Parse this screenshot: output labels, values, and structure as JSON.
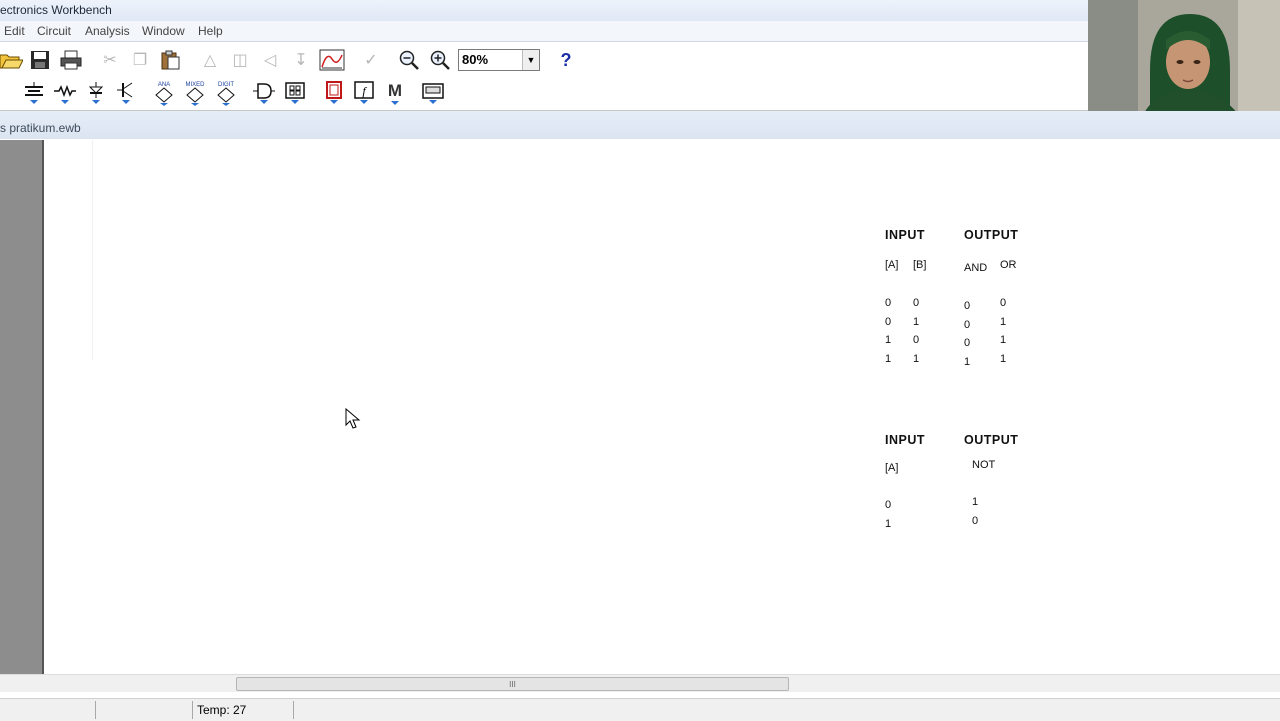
{
  "window": {
    "title": "ectronics Workbench"
  },
  "menu": {
    "items": [
      "Edit",
      "Circuit",
      "Analysis",
      "Window",
      "Help"
    ]
  },
  "toolbar": {
    "zoom_value": "80%",
    "help_label": "?",
    "analyzer_label": "M"
  },
  "components": {
    "analog_label": "ANA",
    "mixed_label": "MIXED",
    "digital_label": "DIGIT"
  },
  "document": {
    "title": "s pratikum.ewb"
  },
  "truth_table_and_or": {
    "input_header": "INPUT",
    "output_header": "OUTPUT",
    "col_a": "[A]",
    "col_b": "[B]",
    "col_and": "AND",
    "col_or": "OR",
    "rows": [
      {
        "a": "0",
        "b": "0",
        "and": "0",
        "or": "0"
      },
      {
        "a": "0",
        "b": "1",
        "and": "0",
        "or": "1"
      },
      {
        "a": "1",
        "b": "0",
        "and": "0",
        "or": "1"
      },
      {
        "a": "1",
        "b": "1",
        "and": "1",
        "or": "1"
      }
    ]
  },
  "truth_table_not": {
    "input_header": "INPUT",
    "output_header": "OUTPUT",
    "col_a": "[A]",
    "col_not": "NOT",
    "rows": [
      {
        "a": "0",
        "not": "1"
      },
      {
        "a": "1",
        "not": "0"
      }
    ]
  },
  "statusbar": {
    "temp": "Temp: 27"
  },
  "scrollbar": {
    "thumb_grip": "III"
  }
}
